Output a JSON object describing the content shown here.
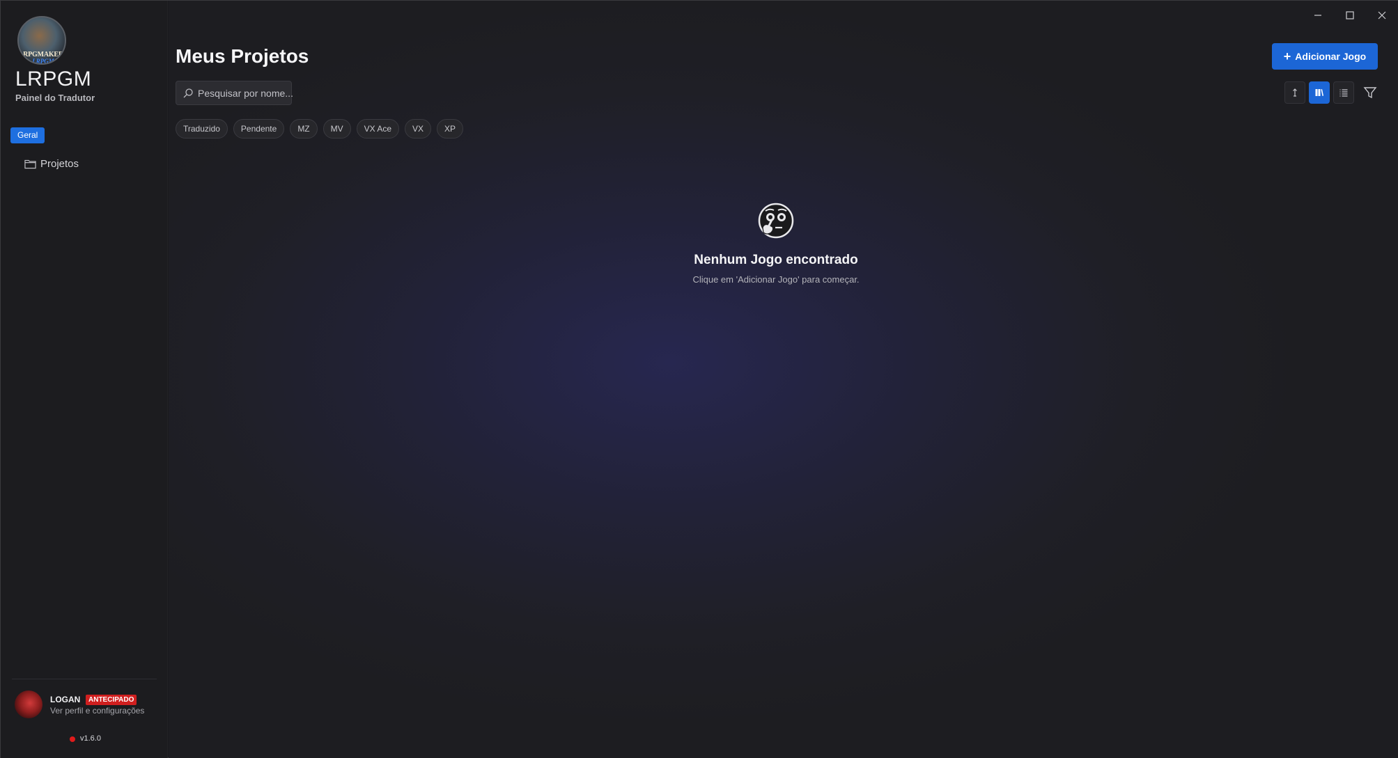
{
  "sidebar": {
    "logo_text": "RPGMAKER",
    "logo_subtext": "LRPGM",
    "app_name": "LRPGM",
    "app_subtitle": "Painel do Tradutor",
    "section_tag": "Geral",
    "nav_items": [
      {
        "label": "Projetos",
        "icon": "folder-icon"
      }
    ],
    "user": {
      "name": "LOGAN",
      "badge": "ANTECIPADO",
      "link": "Ver perfil e configurações"
    },
    "version": "v1.6.0",
    "status_color": "#e01b1b"
  },
  "window_controls": [
    "minimize-icon",
    "maximize-icon",
    "close-icon"
  ],
  "main": {
    "title": "Meus Projetos",
    "add_button_label": "Adicionar Jogo",
    "search_placeholder": "Pesquisar por nome...",
    "filters": [
      "Traduzido",
      "Pendente",
      "MZ",
      "MV",
      "VX Ace",
      "VX",
      "XP"
    ],
    "view_modes": [
      {
        "icon": "sort-icon",
        "active": false
      },
      {
        "icon": "grid-view-icon",
        "active": true
      },
      {
        "icon": "list-view-icon",
        "active": false
      }
    ],
    "empty_state": {
      "icon": "thinking-face-icon",
      "title": "Nenhum Jogo encontrado",
      "subtitle": "Clique em 'Adicionar Jogo' para começar."
    }
  },
  "colors": {
    "accent": "#1c66d6",
    "badge": "#d01f1f"
  }
}
